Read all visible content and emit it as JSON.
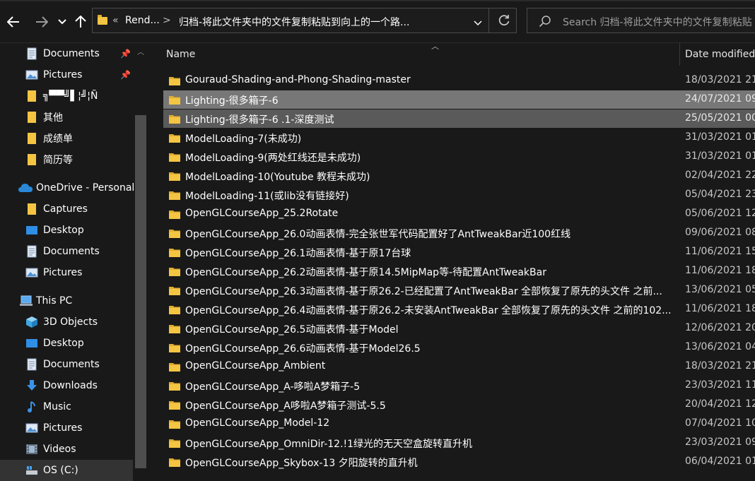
{
  "nav": {
    "back_icon": "arrow-left-icon",
    "forward_icon": "arrow-right-icon",
    "recent_icon": "chevron-down-icon",
    "up_icon": "arrow-up-icon"
  },
  "address": {
    "overflow": "«",
    "crumb1": "Rend...",
    "sep": ">",
    "crumb2": "归档-将此文件夹中的文件复制粘贴到向上的一个路...",
    "dropdown_icon": "chevron-down-icon",
    "refresh_icon": "refresh-icon"
  },
  "search": {
    "placeholder": "Search 归档-将此文件夹中的文件复制粘贴",
    "icon": "search-icon"
  },
  "sidebar": {
    "items": [
      {
        "label": "Documents",
        "icon": "documents-icon",
        "pinned": true
      },
      {
        "label": "Pictures",
        "icon": "pictures-icon",
        "pinned": true
      },
      {
        "label": "╗▀▀╝▌¦╝¦Ñ",
        "icon": "folder-icon"
      },
      {
        "label": "其他",
        "icon": "folder-icon"
      },
      {
        "label": "成绩单",
        "icon": "folder-icon"
      },
      {
        "label": "简历等",
        "icon": "folder-icon"
      },
      {
        "label": "OneDrive - Personal",
        "icon": "onedrive-icon"
      },
      {
        "label": "Captures",
        "icon": "folder-icon"
      },
      {
        "label": "Desktop",
        "icon": "desktop-icon"
      },
      {
        "label": "Documents",
        "icon": "documents-icon"
      },
      {
        "label": "Pictures",
        "icon": "pictures-icon"
      },
      {
        "label": "This PC",
        "icon": "this-pc-icon"
      },
      {
        "label": "3D Objects",
        "icon": "3d-objects-icon"
      },
      {
        "label": "Desktop",
        "icon": "desktop-icon"
      },
      {
        "label": "Documents",
        "icon": "documents-icon"
      },
      {
        "label": "Downloads",
        "icon": "downloads-icon"
      },
      {
        "label": "Music",
        "icon": "music-icon"
      },
      {
        "label": "Pictures",
        "icon": "pictures-icon"
      },
      {
        "label": "Videos",
        "icon": "videos-icon"
      },
      {
        "label": "OS (C:)",
        "icon": "drive-icon"
      }
    ]
  },
  "columns": {
    "name": "Name",
    "date": "Date modified"
  },
  "files": [
    {
      "name": "Gouraud-Shading-and-Phong-Shading-master",
      "date": "18/03/2021 21:"
    },
    {
      "name": "Lighting-很多箱子-6",
      "date": "24/07/2021 09:"
    },
    {
      "name": "Lighting-很多箱子-6 .1-深度测试",
      "date": "25/05/2021 00:"
    },
    {
      "name": "ModelLoading-7(未成功)",
      "date": "31/03/2021 01:"
    },
    {
      "name": "ModelLoading-9(两处红线还是未成功)",
      "date": "31/03/2021 01:"
    },
    {
      "name": "ModelLoading-10(Youtube 教程未成功)",
      "date": "02/04/2021 22:"
    },
    {
      "name": "ModelLoading-11(或lib没有链接好)",
      "date": "05/04/2021 23:"
    },
    {
      "name": "OpenGLCourseApp_25.2Rotate",
      "date": "05/06/2021 12:"
    },
    {
      "name": "OpenGLCourseApp_26.0动画表情-完全张世军代码配置好了AntTweakBar近100红线",
      "date": "09/06/2021 08:"
    },
    {
      "name": "OpenGLCourseApp_26.1动画表情-基于原17台球",
      "date": "11/06/2021 15:"
    },
    {
      "name": "OpenGLCourseApp_26.2动画表情-基于原14.5MipMap等-待配置AntTweakBar",
      "date": "11/06/2021 18:"
    },
    {
      "name": "OpenGLCourseApp_26.3动画表情-基于原26.2-已经配置了AntTweakBar 全部恢复了原先的头文件 之前...",
      "date": "13/06/2021 05:"
    },
    {
      "name": "OpenGLCourseApp_26.4动画表情-基于原26.2-未安装AntTweakBar 全部恢复了原先的头文件 之前的102...",
      "date": "11/06/2021 18:"
    },
    {
      "name": "OpenGLCourseApp_26.5动画表情-基于Model",
      "date": "12/06/2021 20:"
    },
    {
      "name": "OpenGLCourseApp_26.6动画表情-基于Model26.5",
      "date": "13/06/2021 04:"
    },
    {
      "name": "OpenGLCourseApp_Ambient",
      "date": "18/03/2021 21:"
    },
    {
      "name": "OpenGLCourseApp_A-哆啦A梦箱子-5",
      "date": "23/03/2021 11:"
    },
    {
      "name": "OpenGLCourseApp_A哆啦A梦箱子测试-5.5",
      "date": "20/04/2021 12:"
    },
    {
      "name": "OpenGLCourseApp_Model-12",
      "date": "07/04/2021 10:"
    },
    {
      "name": "OpenGLCourseApp_OmniDir-12.!1绿光的无天空盒旋转直升机",
      "date": "23/03/2021 09:"
    },
    {
      "name": "OpenGLCourseApp_Skybox-13 夕阳旋转的直升机",
      "date": "06/04/2021 01:"
    }
  ],
  "colors": {
    "background": "#191919",
    "selected_row": "#777777",
    "folder": "#f4c542",
    "onedrive": "#2b88d8"
  }
}
